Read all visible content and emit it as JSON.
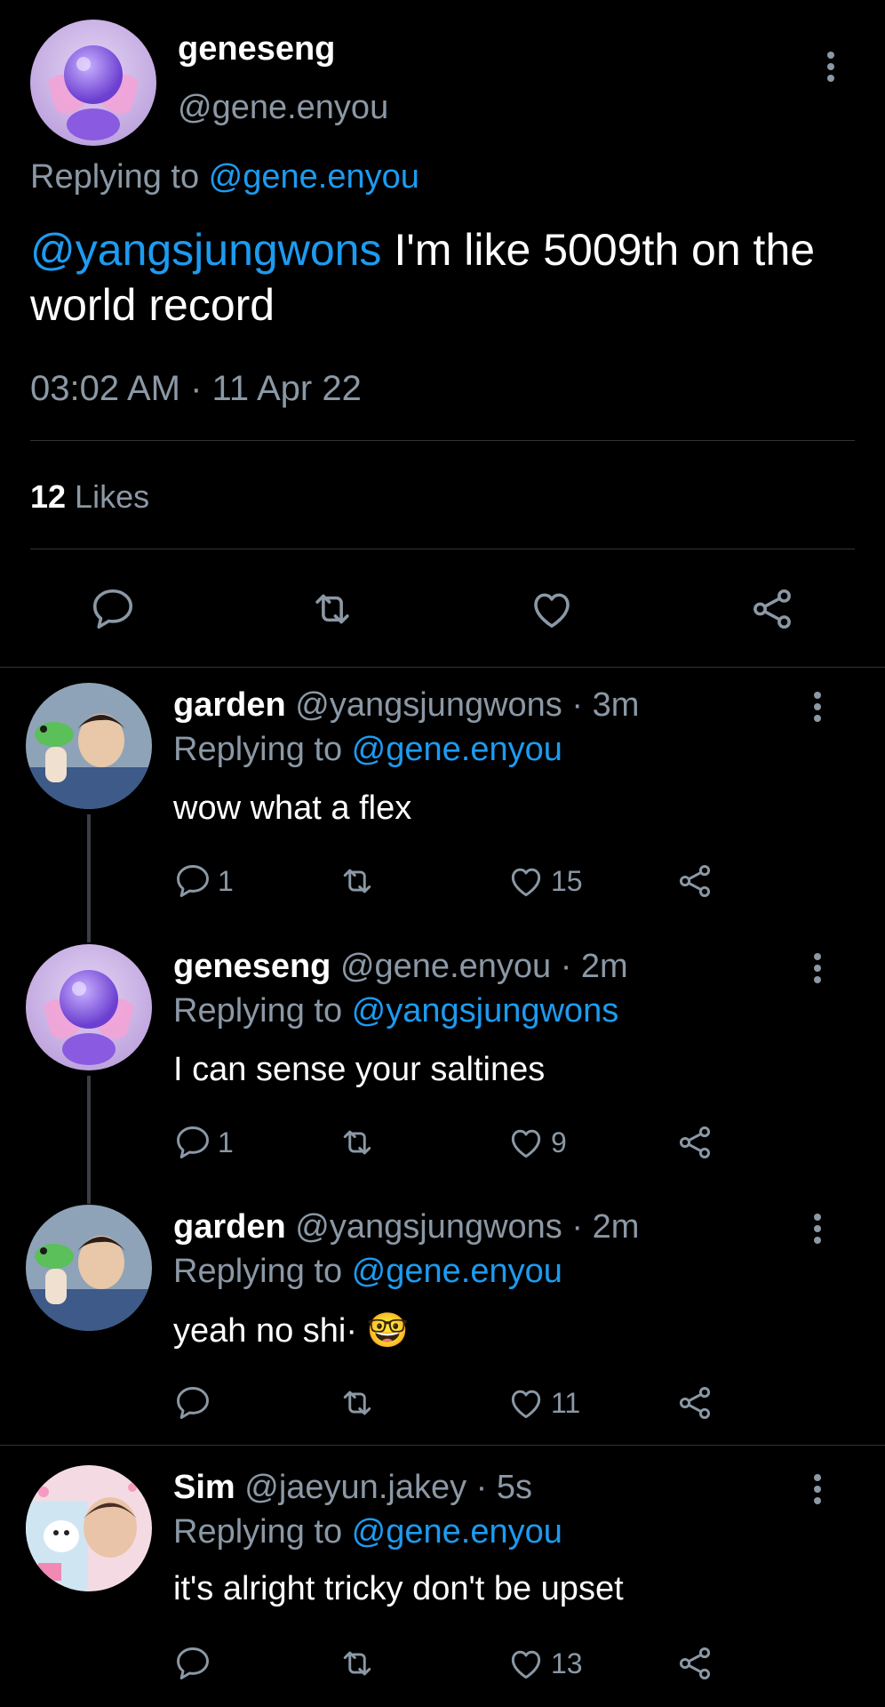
{
  "main_tweet": {
    "display_name": "geneseng",
    "handle": "@gene.enyou",
    "replying_prefix": "Replying to ",
    "replying_to": "@gene.enyou",
    "mention": "@yangsjungwons",
    "text": " I'm like 5009th on the world record",
    "timestamp": "03:02 AM · 11 Apr 22",
    "likes_count": "12",
    "likes_label": " Likes"
  },
  "replies": [
    {
      "display_name": "garden",
      "handle": "@yangsjungwons",
      "time": " · 3m",
      "replying_prefix": "Replying to ",
      "replying_to": "@gene.enyou",
      "text": "wow what a flex",
      "reply_count": "1",
      "like_count": "15",
      "avatar": "garden-avatar"
    },
    {
      "display_name": "geneseng",
      "handle": "@gene.enyou",
      "time": " · 2m",
      "replying_prefix": "Replying to ",
      "replying_to": "@yangsjungwons",
      "text": "I can sense your saltines",
      "reply_count": "1",
      "like_count": "9",
      "avatar": "geneseng-avatar"
    },
    {
      "display_name": "garden",
      "handle": "@yangsjungwons",
      "time": " · 2m",
      "replying_prefix": "Replying to ",
      "replying_to": "@gene.enyou",
      "text": "yeah no shi· ",
      "emoji": "🤓",
      "reply_count": "",
      "like_count": "11",
      "avatar": "garden-avatar"
    },
    {
      "display_name": "Sim",
      "handle": "@jaeyun.jakey",
      "time": " · 5s",
      "replying_prefix": "Replying to ",
      "replying_to": "@gene.enyou",
      "text": "it's alright tricky don't be upset",
      "reply_count": "",
      "like_count": "13",
      "avatar": "sim-avatar"
    }
  ],
  "icons": {
    "reply": "reply-icon",
    "retweet": "retweet-icon",
    "like": "heart-icon",
    "share": "share-icon",
    "more": "more-vertical-icon"
  },
  "colors": {
    "background": "#000000",
    "text": "#e7e9ea",
    "secondary": "#8b98a5",
    "link": "#1d9bf0",
    "divider": "#2f3336"
  }
}
